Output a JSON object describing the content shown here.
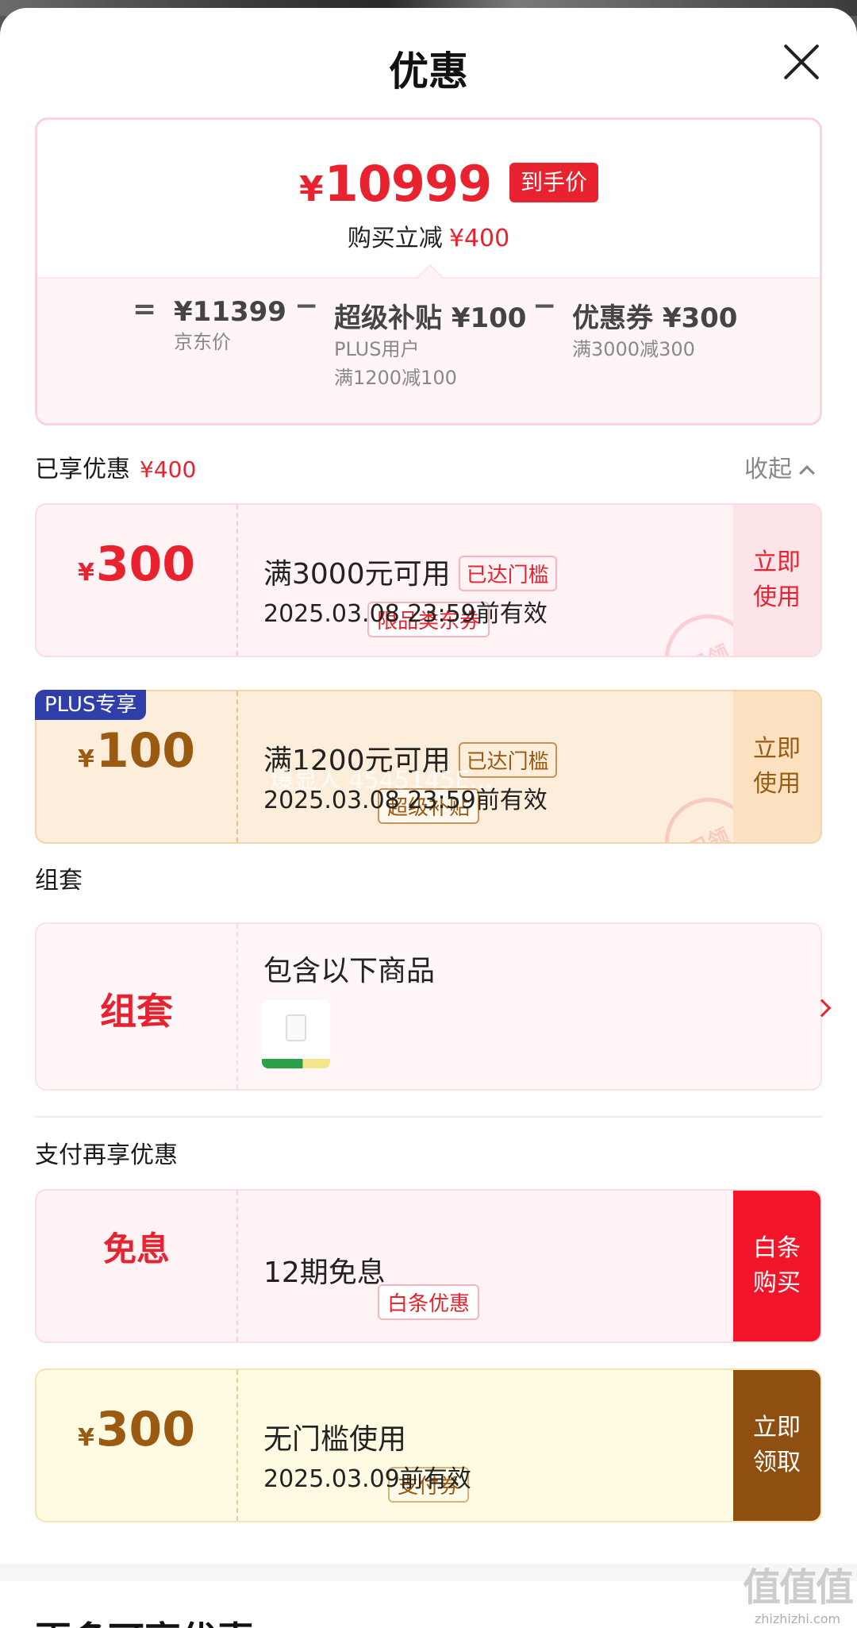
{
  "header": {
    "title": "优惠"
  },
  "summary": {
    "currency": "¥",
    "final_price": "10999",
    "final_tag": "到手价",
    "reduce_label": "购买立减",
    "reduce_amount": "¥400",
    "equals": "=",
    "minus": "−",
    "jd_price": "¥11399",
    "jd_price_label": "京东价",
    "subsidy": "超级补贴 ¥100",
    "subsidy_line1": "PLUS用户",
    "subsidy_line2": "满1200减100",
    "coupon": "优惠券 ¥300",
    "coupon_line": "满3000减300"
  },
  "enjoyed": {
    "label": "已享优惠",
    "amount": "¥400",
    "collapse_label": "收起"
  },
  "coupons": [
    {
      "currency": "¥",
      "amount": "300",
      "type": "限品类东券",
      "condition": "满3000元可用",
      "reached": "已达门槛",
      "validity": "2025.03.08 23:59前有效",
      "action": "立即使用",
      "stamp": "已领"
    },
    {
      "badge": "PLUS专享",
      "currency": "¥",
      "amount": "100",
      "type": "超级补贴",
      "condition": "满1200元可用",
      "reached": "已达门槛",
      "validity": "2025.03.08 23:59前有效",
      "action": "立即使用",
      "stamp": "已领"
    }
  ],
  "bundle": {
    "section_label": "组套",
    "label": "组套",
    "title": "包含以下商品"
  },
  "payment": {
    "section_label": "支付再享优惠",
    "baitiao": {
      "label": "免息",
      "tag": "白条优惠",
      "text": "12期免息",
      "action": "白条购买"
    },
    "pay_coupon": {
      "currency": "¥",
      "amount": "300",
      "type": "支付券",
      "condition": "无门槛使用",
      "validity": "2025.03.09前有效",
      "action": "立即领取"
    }
  },
  "more": {
    "title": "更多可享优惠"
  },
  "watermark": {
    "glyphs": "值值值",
    "site": "zhizhizhi.com"
  },
  "overlay": {
    "text": "爆显人 4545145E..."
  },
  "colors": {
    "red": "#e8222e",
    "brown": "#9a5a12",
    "plus_blue": "#2f3ea8"
  }
}
